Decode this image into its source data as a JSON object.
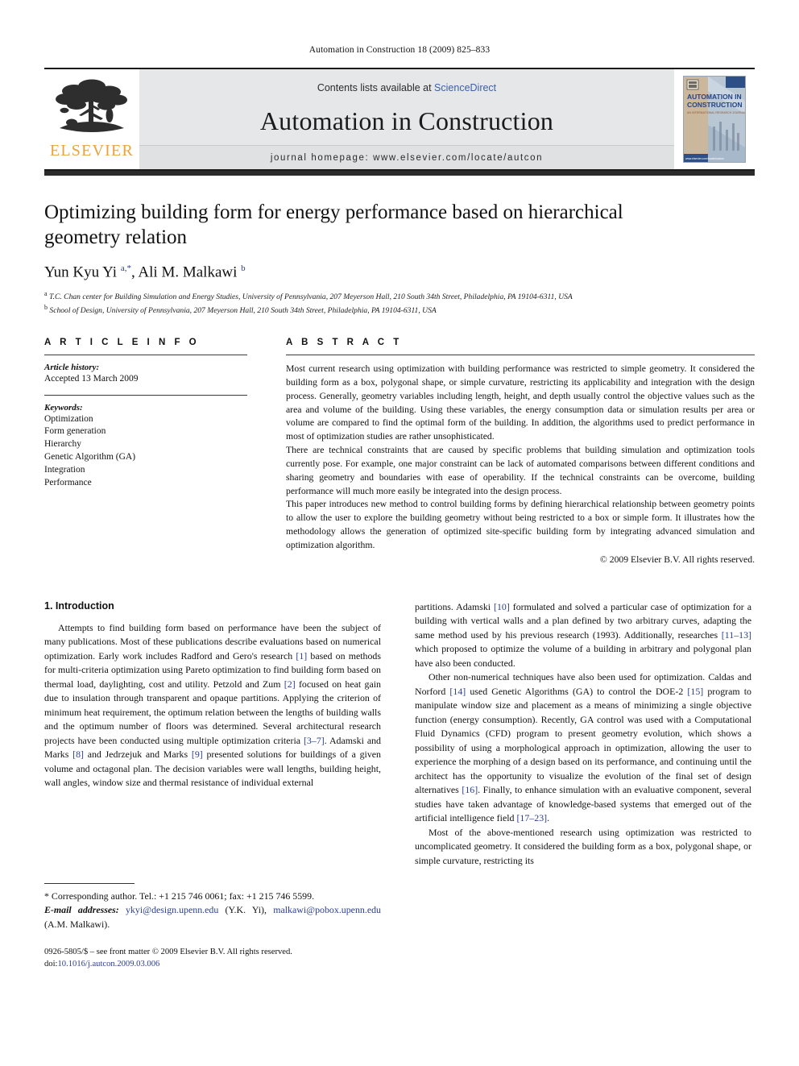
{
  "running_head": "Automation in Construction 18 (2009) 825–833",
  "masthead": {
    "publisher_name": "ELSEVIER",
    "contents_prefix": "Contents lists available at ",
    "contents_link": "ScienceDirect",
    "journal_title": "Automation in Construction",
    "homepage": "journal homepage: www.elsevier.com/locate/autcon",
    "cover_title_line1": "AUTOMATION IN",
    "cover_title_line2": "CONSTRUCTION",
    "cover_subtitle": "AN INTERNATIONAL RESEARCH JOURNAL",
    "cover_footer": "www.elsevier.com/locate/autcon"
  },
  "article": {
    "title": "Optimizing building form for energy performance based on hierarchical geometry relation",
    "authors_html": "Yun Kyu Yi <sup>a,<span class=\"star\">*</span></sup>, Ali M. Malkawi <sup>b</sup>",
    "affiliation_a": "T.C. Chan center for Building Simulation and Energy Studies, University of Pennsylvania, 207 Meyerson Hall, 210 South 34th Street, Philadelphia, PA 19104-6311, USA",
    "affiliation_b": "School of Design, University of Pennsylvania, 207 Meyerson Hall, 210 South 34th Street, Philadelphia, PA 19104-6311, USA"
  },
  "article_info": {
    "heading": "A R T I C L E    I N F O",
    "history_label": "Article history:",
    "history_value": "Accepted 13 March 2009",
    "keywords_label": "Keywords:",
    "keywords": [
      "Optimization",
      "Form generation",
      "Hierarchy",
      "Genetic Algorithm (GA)",
      "Integration",
      "Performance"
    ]
  },
  "abstract": {
    "heading": "A B S T R A C T",
    "paragraphs": [
      "Most current research using optimization with building performance was restricted to simple geometry. It considered the building form as a box, polygonal shape, or simple curvature, restricting its applicability and integration with the design process. Generally, geometry variables including length, height, and depth usually control the objective values such as the area and volume of the building. Using these variables, the energy consumption data or simulation results per area or volume are compared to find the optimal form of the building. In addition, the algorithms used to predict performance in most of optimization studies are rather unsophisticated.",
      "There are technical constraints that are caused by specific problems that building simulation and optimization tools currently pose. For example, one major constraint can be lack of automated comparisons between different conditions and sharing geometry and boundaries with ease of operability. If the technical constraints can be overcome, building performance will much more easily be integrated into the design process.",
      "This paper introduces new method to control building forms by defining hierarchical relationship between geometry points to allow the user to explore the building geometry without being restricted to a box or simple form. It illustrates how the methodology allows the generation of optimized site-specific building form by integrating advanced simulation and optimization algorithm."
    ],
    "copyright": "© 2009 Elsevier B.V. All rights reserved."
  },
  "introduction": {
    "section_title": "1. Introduction",
    "left_paragraph_1": "Attempts to find building form based on performance have been the subject of many publications. Most of these publications describe evaluations based on numerical optimization. Early work includes Radford and Gero's research [1] based on methods for multi-criteria optimization using Pareto optimization to find building form based on thermal load, daylighting, cost and utility. Petzold and Zum [2] focused on heat gain due to insulation through transparent and opaque partitions. Applying the criterion of minimum heat requirement, the optimum relation between the lengths of building walls and the optimum number of floors was determined. Several architectural research projects have been conducted using multiple optimization criteria [3–7]. Adamski and Marks [8] and Jedrzejuk and Marks [9] presented solutions for buildings of a given volume and octagonal plan. The decision variables were wall lengths, building height, wall angles, window size and thermal resistance of individual external",
    "right_paragraph_1": "partitions. Adamski [10] formulated and solved a particular case of optimization for a building with vertical walls and a plan defined by two arbitrary curves, adapting the same method used by his previous research (1993). Additionally, researches [11–13] which proposed to optimize the volume of a building in arbitrary and polygonal plan have also been conducted.",
    "right_paragraph_2": "Other non-numerical techniques have also been used for optimization. Caldas and Norford [14] used Genetic Algorithms (GA) to control the DOE-2 [15] program to manipulate window size and placement as a means of minimizing a single objective function (energy consumption). Recently, GA control was used with a Computational Fluid Dynamics (CFD) program to present geometry evolution, which shows a possibility of using a morphological approach in optimization, allowing the user to experience the morphing of a design based on its performance, and continuing until the architect has the opportunity to visualize the evolution of the final set of design alternatives [16]. Finally, to enhance simulation with an evaluative component, several studies have taken advantage of knowledge-based systems that emerged out of the artificial intelligence field [17–23].",
    "right_paragraph_3": "Most of the above-mentioned research using optimization was restricted to uncomplicated geometry. It considered the building form as a box, polygonal shape, or simple curvature, restricting its"
  },
  "footnote": {
    "corresponding": "Corresponding author. Tel.: +1 215 746 0061; fax: +1 215 746 5599.",
    "email_label": "E-mail addresses:",
    "email_1": "ykyi@design.upenn.edu",
    "email_1_owner": "(Y.K. Yi),",
    "email_2": "malkawi@pobox.upenn.edu",
    "email_2_owner": "(A.M. Malkawi)."
  },
  "footer": {
    "issn_line": "0926-5805/$ – see front matter © 2009 Elsevier B.V. All rights reserved.",
    "doi_label": "doi:",
    "doi_value": "10.1016/j.autcon.2009.03.006"
  },
  "colors": {
    "link_blue": "#2b3f8c",
    "sciencedirect_blue": "#3b5fa8",
    "elsevier_orange": "#E8A33D",
    "masthead_gray": "#e6e7e8",
    "rule_dark": "#2b2b2b"
  }
}
